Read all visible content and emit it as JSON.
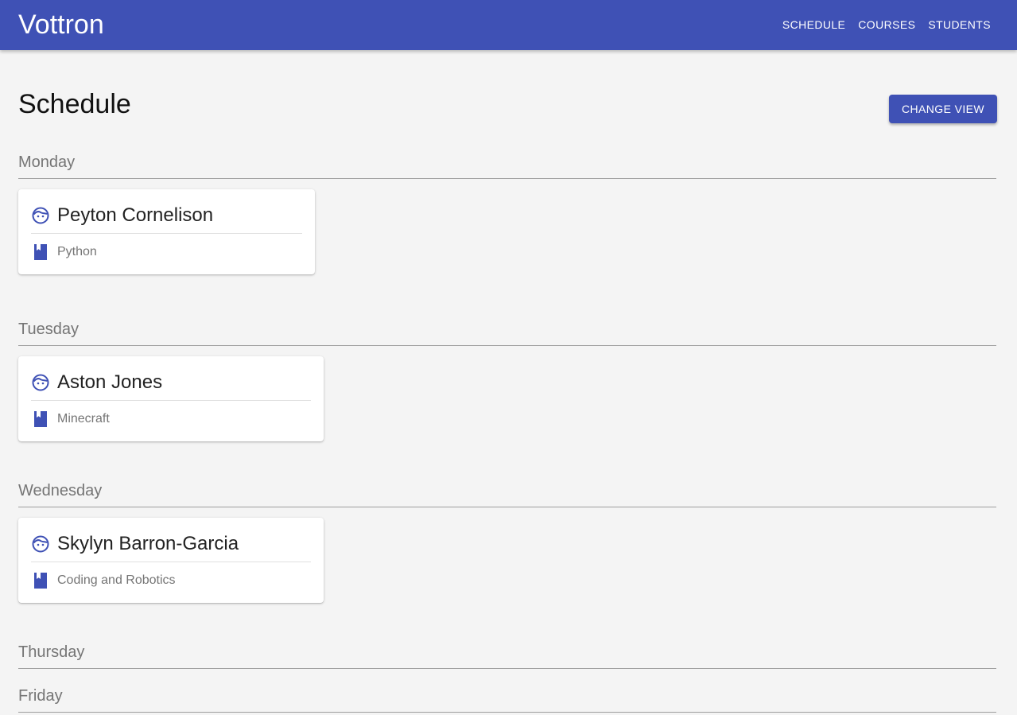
{
  "app": {
    "brand": "Vottron"
  },
  "nav": {
    "items": [
      {
        "label": "SCHEDULE"
      },
      {
        "label": "COURSES"
      },
      {
        "label": "STUDENTS"
      }
    ]
  },
  "page": {
    "title": "Schedule",
    "change_view_label": "CHANGE VIEW"
  },
  "colors": {
    "primary": "#3f51b5",
    "background": "#f4f4f4"
  },
  "icons": {
    "student": "face-icon",
    "course": "book-icon"
  },
  "days": [
    {
      "name": "Monday",
      "sessions": [
        {
          "student": "Peyton Cornelison",
          "course": "Python"
        }
      ]
    },
    {
      "name": "Tuesday",
      "sessions": [
        {
          "student": "Aston Jones",
          "course": "Minecraft"
        }
      ]
    },
    {
      "name": "Wednesday",
      "sessions": [
        {
          "student": "Skylyn Barron-Garcia",
          "course": "Coding and Robotics"
        }
      ]
    },
    {
      "name": "Thursday",
      "sessions": []
    },
    {
      "name": "Friday",
      "sessions": []
    }
  ]
}
